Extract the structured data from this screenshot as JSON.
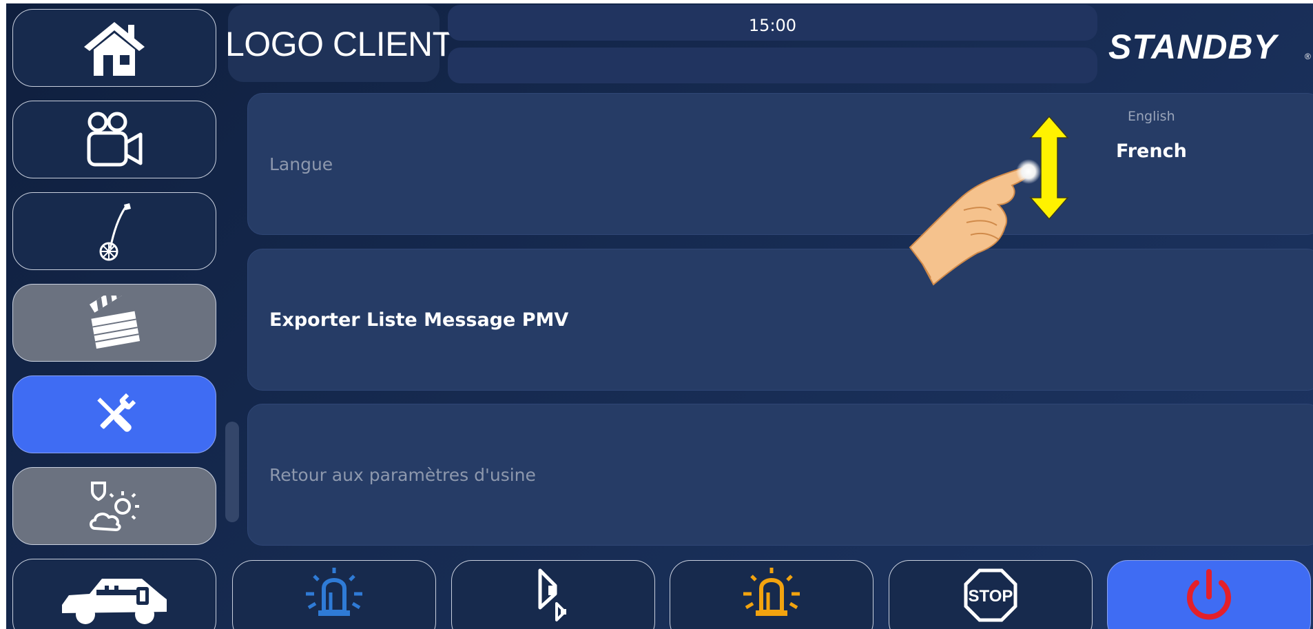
{
  "header": {
    "client_logo_text": "LOGO CLIENT",
    "time": "15:00",
    "message": "",
    "brand": "STANDBY",
    "brand_mark": "®"
  },
  "sidebar": {
    "items": [
      {
        "name": "home",
        "icon": "home-icon",
        "state": "normal"
      },
      {
        "name": "camera",
        "icon": "video-camera-icon",
        "state": "normal"
      },
      {
        "name": "measuring-wheel",
        "icon": "measuring-wheel-icon",
        "state": "normal"
      },
      {
        "name": "clapperboard",
        "icon": "clapperboard-icon",
        "state": "disabled"
      },
      {
        "name": "settings",
        "icon": "tools-icon",
        "state": "active"
      },
      {
        "name": "weather",
        "icon": "weather-icon",
        "state": "disabled"
      },
      {
        "name": "vehicle",
        "icon": "vehicle-key-icon",
        "state": "normal"
      }
    ]
  },
  "settings": {
    "language": {
      "label": "Langue",
      "options": [
        "English",
        "French"
      ],
      "selected": "French"
    },
    "export": {
      "label": "Exporter Liste Message PMV"
    },
    "factory_reset": {
      "label": "Retour aux paramètres d'usine"
    }
  },
  "bottom_bar": [
    {
      "name": "blue-beacon",
      "icon": "beacon-icon",
      "color": "#2f7bd6"
    },
    {
      "name": "horn",
      "icon": "horn-icon",
      "color": "#ffffff"
    },
    {
      "name": "orange-beacon",
      "icon": "beacon-icon",
      "color": "#f2a30f"
    },
    {
      "name": "stop",
      "icon": "stop-sign-icon",
      "label": "STOP",
      "color": "#ffffff"
    },
    {
      "name": "power",
      "icon": "power-icon",
      "color": "#e3202a"
    }
  ],
  "colors": {
    "active": "#3f6cf3",
    "disabled": "#6b7280",
    "gesture_arrow": "#fff200",
    "background": "#152850"
  },
  "gesture_hint": {
    "icon": "swipe-vertical-hand-icon"
  }
}
